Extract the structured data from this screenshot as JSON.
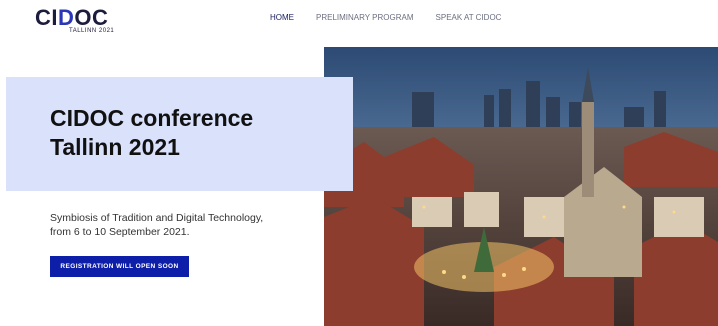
{
  "logo": {
    "text_before": "CI",
    "text_d": "D",
    "text_after": "OC",
    "subtitle": "TALLINN 2021"
  },
  "nav": {
    "items": [
      {
        "label": "HOME",
        "active": true
      },
      {
        "label": "PRELIMINARY PROGRAM",
        "active": false
      },
      {
        "label": "SPEAK AT CIDOC",
        "active": false
      }
    ]
  },
  "hero": {
    "title_line1": "CIDOC conference",
    "title_line2": "Tallinn 2021",
    "description_line1": "Symbiosis of Tradition and Digital Technology,",
    "description_line2": "from 6 to 10 September 2021.",
    "button_label": "REGISTRATION WILL OPEN SOON"
  },
  "colors": {
    "accent": "#0d1fa8",
    "hero_box": "#d9e1fb",
    "nav_active": "#1c2060"
  }
}
